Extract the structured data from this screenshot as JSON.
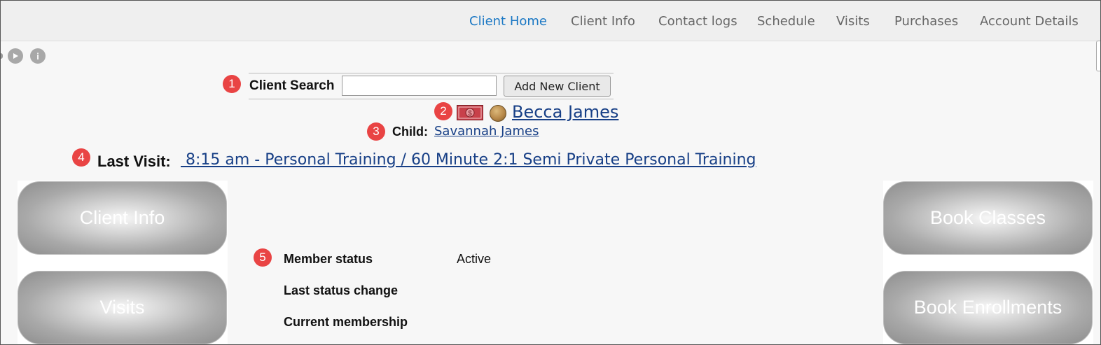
{
  "topnav": {
    "items": [
      {
        "label": "Client Home",
        "active": true
      },
      {
        "label": "Client Info"
      },
      {
        "label": "Contact logs"
      },
      {
        "label": "Schedule"
      },
      {
        "label": "Visits"
      },
      {
        "label": "Purchases"
      },
      {
        "label": "Account Details"
      }
    ]
  },
  "toolbar": {
    "play_icon": "play-icon",
    "info_icon": "info-icon",
    "info_glyph": "i"
  },
  "badges": [
    "1",
    "2",
    "3",
    "4",
    "5"
  ],
  "search": {
    "label": "Client Search",
    "value": "",
    "placeholder": "",
    "add_button": "Add New Client"
  },
  "client": {
    "name": "Becca James",
    "icons": [
      "money-icon",
      "coin-icon"
    ]
  },
  "child": {
    "label": "Child:",
    "name": "Savannah James"
  },
  "last_visit": {
    "label": "Last Visit:",
    "value": " 8:15 am - Personal Training / 60 Minute 2:1 Semi Private Personal Training"
  },
  "left_buttons": [
    "Client Info",
    "Visits"
  ],
  "right_buttons": [
    "Book Classes",
    "Book Enrollments"
  ],
  "status": {
    "rows": [
      {
        "label": "Member status",
        "value": "Active"
      },
      {
        "label": "Last status change",
        "value": ""
      },
      {
        "label": "Current membership",
        "value": ""
      }
    ]
  },
  "colors": {
    "accent": "#1b78c4",
    "link": "#173f86",
    "badge": "#e94444"
  }
}
